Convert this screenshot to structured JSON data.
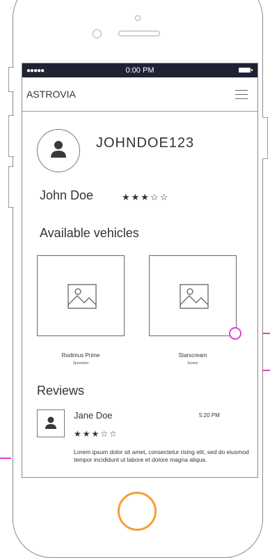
{
  "status_bar": {
    "signal": "●●●●●",
    "time": "0:00 PM"
  },
  "nav": {
    "brand": "ASTROVIA"
  },
  "profile": {
    "username": "JOHNDOE123",
    "full_name": "John Doe",
    "rating_stars": "★★★☆☆",
    "rating": 3
  },
  "vehicles": {
    "heading": "Available vehicles",
    "items": [
      {
        "name": "Rodimus Prime",
        "type": "Speedster"
      },
      {
        "name": "Starscream",
        "type": "Seeker"
      }
    ]
  },
  "reviews": {
    "heading": "Reviews",
    "items": [
      {
        "author": "Jane Doe",
        "time": "5:20 PM",
        "rating_stars": "★★★☆☆",
        "rating": 3,
        "text": "Lorem ipsum dolor sit amet, consectetur rising elit, sed do eiusmod tempor incididunt ut labore et dolore magna aliqua."
      }
    ]
  },
  "colors": {
    "status_bar": "#1e2233",
    "home_button": "#f5a030",
    "annotation": "#e040c8"
  }
}
